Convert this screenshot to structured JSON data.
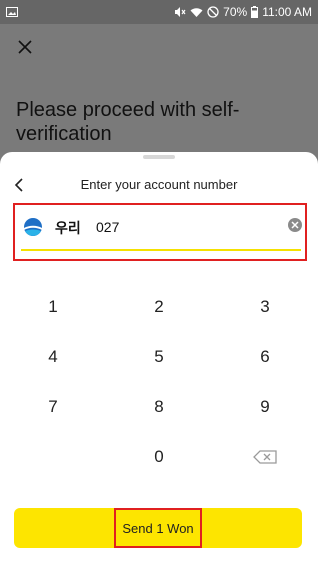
{
  "status_bar": {
    "battery": "70%",
    "time": "11:00 AM",
    "icons": [
      "image-icon",
      "mute-icon",
      "wifi-icon",
      "no-sign-icon",
      "battery-icon"
    ]
  },
  "backdrop": {
    "title": "Please proceed with self-verification"
  },
  "sheet": {
    "title": "Enter your account number",
    "bank_name": "우리",
    "account_value": "027",
    "keys": [
      "1",
      "2",
      "3",
      "4",
      "5",
      "6",
      "7",
      "8",
      "9",
      "0"
    ],
    "send_label": "Send 1 Won"
  },
  "colors": {
    "accent": "#fde500",
    "highlight": "#e02020",
    "backdrop": "#7a7a7a"
  }
}
